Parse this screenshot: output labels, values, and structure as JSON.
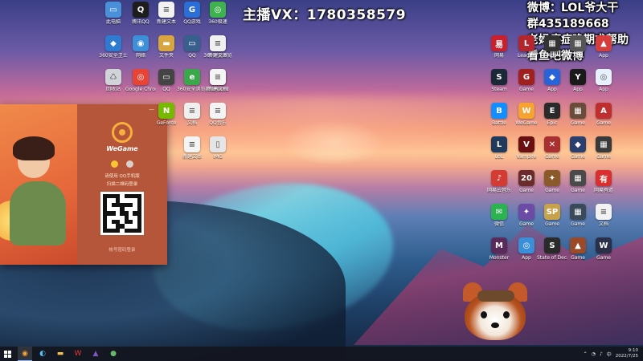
{
  "overlay": {
    "streamer_contact": "主播VX：1780358579",
    "weibo_line": "微博：LOL爷大干",
    "group_line": "群435189668",
    "plea_line": "老妈癌症晚期求帮助",
    "watch_line": "看鱼吧微博"
  },
  "desktop": {
    "icons": [
      {
        "label": "此电脑",
        "icon": "computer-icon",
        "color": "#4a90d9",
        "glyph": "▭"
      },
      {
        "label": "腾讯QQ",
        "icon": "qq-icon",
        "color": "#1d1d1d",
        "glyph": "Q"
      },
      {
        "label": "新建文本",
        "icon": "document-icon",
        "color": "#f2f2f2",
        "glyph": "≡"
      },
      {
        "label": "QQ游戏",
        "icon": "qq-game-icon",
        "color": "#2b6fd6",
        "glyph": "G"
      },
      {
        "label": "360极速",
        "icon": "browser-360-icon",
        "color": "#3fb24f",
        "glyph": "◎"
      },
      {
        "label": "360安全卫士",
        "icon": "shield-icon",
        "color": "#2f7bd1",
        "glyph": "◆"
      },
      {
        "label": "网络",
        "icon": "network-icon",
        "color": "#3d8fd8",
        "glyph": "◉"
      },
      {
        "label": "文件夹",
        "icon": "folder-icon",
        "color": "#d8a640",
        "glyph": "▬"
      },
      {
        "label": "QQ",
        "icon": "monitor-icon",
        "color": "#37608c",
        "glyph": "▭"
      },
      {
        "label": "360安全浏览",
        "icon": "browser-icon",
        "color": "#4caf50",
        "glyph": "e"
      },
      {
        "label": "新建文本",
        "icon": "document-icon",
        "color": "#f0f0f0",
        "glyph": "≡"
      },
      {
        "label": "回收站",
        "icon": "recycle-bin-icon",
        "color": "#d0d4d8",
        "glyph": "♺"
      },
      {
        "label": "Google Chrome",
        "icon": "chrome-icon",
        "color": "#e84436",
        "glyph": "◎"
      },
      {
        "label": "QQ",
        "icon": "app-icon",
        "color": "#444",
        "glyph": "▭"
      },
      {
        "label": "360安全浏览器",
        "icon": "ie-icon",
        "color": "#3aa84a",
        "glyph": "e"
      },
      {
        "label": "新建Word",
        "icon": "word-icon",
        "color": "#2b579a",
        "glyph": "W"
      },
      {
        "label": "新建文档",
        "icon": "document-icon",
        "color": "#f4f4f4",
        "glyph": "≡"
      },
      {
        "label": "GeForce",
        "icon": "nvidia-icon",
        "color": "#76b900",
        "glyph": "N"
      },
      {
        "label": "文档",
        "icon": "document-icon",
        "color": "#efefef",
        "glyph": "≡"
      },
      {
        "label": "QQ音乐",
        "icon": "document-icon",
        "color": "#f4f4f4",
        "glyph": "≡"
      },
      {
        "label": "新建文本",
        "icon": "document-icon",
        "color": "#f4f4f4",
        "glyph": "≡"
      },
      {
        "label": "IMG",
        "icon": "phone-icon",
        "color": "#e5e5e5",
        "glyph": "▯"
      }
    ],
    "right_icons": [
      {
        "label": "网易",
        "icon": "netease-icon",
        "color": "#c8202f",
        "glyph": "易"
      },
      {
        "label": "League",
        "icon": "league-icon",
        "color": "#b3262e",
        "glyph": "L"
      },
      {
        "label": "App",
        "icon": "app-icon",
        "color": "#333",
        "glyph": "▦"
      },
      {
        "label": "App",
        "icon": "app-icon",
        "color": "#555",
        "glyph": "▦"
      },
      {
        "label": "App",
        "icon": "app-icon",
        "color": "#d63e3e",
        "glyph": "▲"
      },
      {
        "label": "Steam",
        "icon": "steam-icon",
        "color": "#1b2838",
        "glyph": "S"
      },
      {
        "label": "Game",
        "icon": "game-icon",
        "color": "#a02020",
        "glyph": "G"
      },
      {
        "label": "App",
        "icon": "app-icon",
        "color": "#2864d8",
        "glyph": "◆"
      },
      {
        "label": "App",
        "icon": "app-icon",
        "color": "#1a1a1a",
        "glyph": "Y"
      },
      {
        "label": "App",
        "icon": "app-icon",
        "color": "#e8f2ff",
        "glyph": "◎"
      },
      {
        "label": "Battle",
        "icon": "battlenet-icon",
        "color": "#148eff",
        "glyph": "B"
      },
      {
        "label": "WeGame",
        "icon": "wegame-icon",
        "color": "#f7a331",
        "glyph": "W"
      },
      {
        "label": "Epic",
        "icon": "epic-icon",
        "color": "#2a2a2a",
        "glyph": "E"
      },
      {
        "label": "Game",
        "icon": "game-icon",
        "color": "#6a4c3a",
        "glyph": "▦"
      },
      {
        "label": "Game",
        "icon": "game-icon",
        "color": "#c02f2f",
        "glyph": "A"
      },
      {
        "label": "LoL",
        "icon": "lol-icon",
        "color": "#1f3a5a",
        "glyph": "L"
      },
      {
        "label": "Vampire",
        "icon": "vampire-icon",
        "color": "#6a1010",
        "glyph": "V"
      },
      {
        "label": "Game",
        "icon": "game-icon",
        "color": "#a83030",
        "glyph": "✕"
      },
      {
        "label": "Game",
        "icon": "game-icon",
        "color": "#2b3f6e",
        "glyph": "◆"
      },
      {
        "label": "Game",
        "icon": "game-icon",
        "color": "#3a3a3a",
        "glyph": "▦"
      },
      {
        "label": "网易云音乐",
        "icon": "music-icon",
        "color": "#d43c33",
        "glyph": "♪"
      },
      {
        "label": "Game",
        "icon": "game-icon",
        "color": "#6b2b2b",
        "glyph": "20"
      },
      {
        "label": "Game",
        "icon": "game-icon",
        "color": "#8b5a2b",
        "glyph": "✦"
      },
      {
        "label": "Game",
        "icon": "game-icon",
        "color": "#4a4a4a",
        "glyph": "▦"
      },
      {
        "label": "网易有道",
        "icon": "youdao-icon",
        "color": "#d92f2f",
        "glyph": "有"
      },
      {
        "label": "微信",
        "icon": "wechat-icon",
        "color": "#2bb34f",
        "glyph": "✉"
      },
      {
        "label": "Game",
        "icon": "game-icon",
        "color": "#6b4ba6",
        "glyph": "✦"
      },
      {
        "label": "Game",
        "icon": "game-icon",
        "color": "#c8a24a",
        "glyph": "SP"
      },
      {
        "label": "Game",
        "icon": "game-icon",
        "color": "#3b4a5a",
        "glyph": "▦"
      },
      {
        "label": "文档",
        "icon": "document-icon",
        "color": "#f2f2f2",
        "glyph": "≡"
      },
      {
        "label": "Monster",
        "icon": "game-icon",
        "color": "#5a2a5a",
        "glyph": "M"
      },
      {
        "label": "App",
        "icon": "app-icon",
        "color": "#3a8fd8",
        "glyph": "◎"
      },
      {
        "label": "State of Decay",
        "icon": "game-icon",
        "color": "#2a2a2a",
        "glyph": "S"
      },
      {
        "label": "Game",
        "icon": "game-icon",
        "color": "#9a4a2a",
        "glyph": "▲"
      },
      {
        "label": "Game",
        "icon": "game-icon",
        "color": "#2a2f4a",
        "glyph": "W"
      }
    ]
  },
  "wegame": {
    "brand": "WeGame",
    "tip1": "请使用 QQ手机版",
    "tip2": "扫描二维码登录",
    "footer": "帐号密码登录",
    "controls": [
      "—",
      "✕"
    ]
  },
  "taskbar": {
    "start_icon": "windows-icon",
    "time": "9:10",
    "date": "2022/7/25"
  }
}
